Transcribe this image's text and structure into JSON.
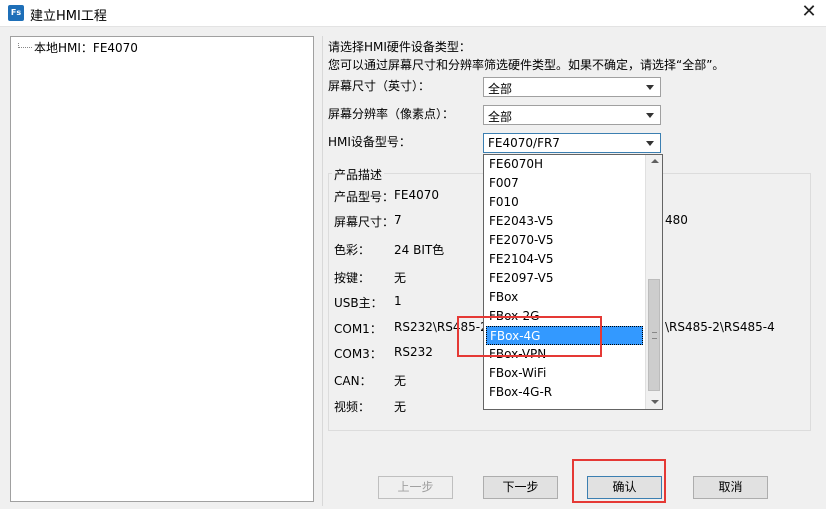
{
  "window": {
    "title": "建立HMI工程",
    "app_icon_text": "Fs",
    "close_glyph": "✕"
  },
  "tree": {
    "root_label": "本地HMI：FE4070"
  },
  "prompt": {
    "line1": "请选择HMI硬件设备类型：",
    "line2": "您可以通过屏幕尺寸和分辨率筛选硬件类型。如果不确定，请选择“全部”。"
  },
  "filters": {
    "screen_size": {
      "label": "屏幕尺寸（英寸）：",
      "value": "全部"
    },
    "resolution": {
      "label": "屏幕分辨率（像素点）：",
      "value": "全部"
    },
    "model": {
      "label": "HMI设备型号：",
      "value": "FE4070/FR7"
    }
  },
  "description": {
    "title": "产品描述",
    "rows": [
      {
        "key": "产品型号：",
        "value": "FE4070"
      },
      {
        "key": "屏幕尺寸：",
        "value": "7"
      },
      {
        "key": "色彩：",
        "value": "24 BIT色"
      },
      {
        "key": "按键：",
        "value": "无"
      },
      {
        "key": "USB主：",
        "value": "1"
      },
      {
        "key": "COM1：",
        "value": "RS232\\RS485-2"
      },
      {
        "key": "COM3：",
        "value": "RS232"
      },
      {
        "key": "CAN：",
        "value": "无"
      },
      {
        "key": "视频：",
        "value": "无"
      }
    ],
    "resolution_partial": "480",
    "com1_partial_right": "\\RS485-2\\RS485-4"
  },
  "dropdown": {
    "items": [
      "FE6070H",
      "F007",
      "F010",
      "FE2043-V5",
      "FE2070-V5",
      "FE2104-V5",
      "FE2097-V5",
      "FBox",
      "FBox-2G",
      "FBox-4G",
      "FBox-VPN",
      "FBox-WiFi",
      "FBox-4G-R"
    ],
    "selected_index": 9,
    "scroll_grip_glyph": "≡"
  },
  "buttons": {
    "prev": "上一步",
    "next": "下一步",
    "ok": "确认",
    "cancel": "取消"
  }
}
